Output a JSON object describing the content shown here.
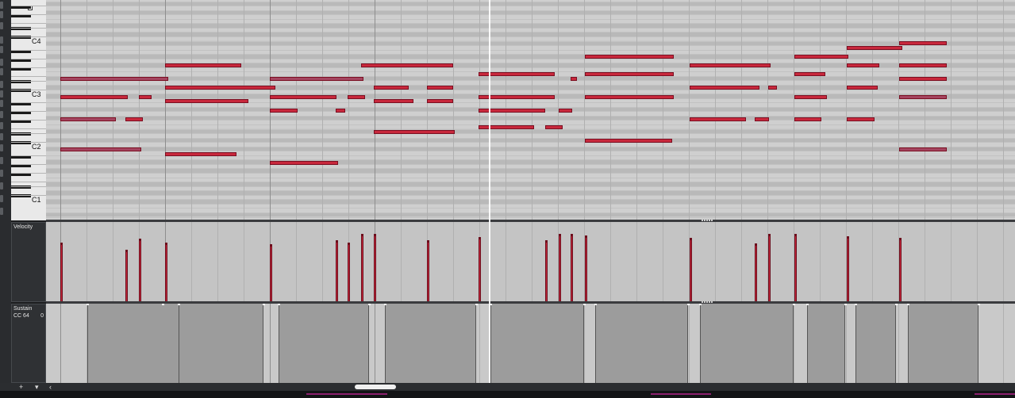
{
  "keyboard": {
    "octave_labels": [
      "C4",
      "C3",
      "C2",
      "C1"
    ]
  },
  "lanes": {
    "velocity": {
      "label": "Velocity"
    },
    "sustain": {
      "label": "Sustain",
      "cc_label": "CC 64",
      "value": "0"
    }
  },
  "scroll": {
    "add_label": "+",
    "dropdown_label": "▾",
    "left_arrow": "‹"
  },
  "colors": {
    "note": "#c8283c",
    "note_dim": "#a54560",
    "grid_bg": "#c9c9c9",
    "sustain_block": "#9c9c9c",
    "panel": "#2f3134"
  }
}
